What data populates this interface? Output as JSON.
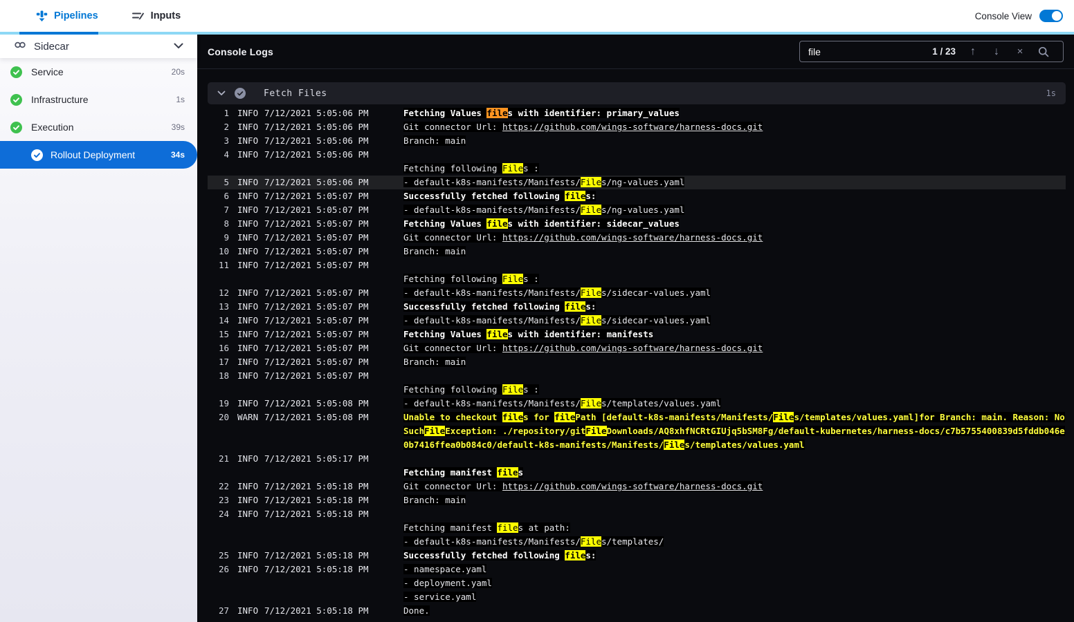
{
  "colors": {
    "accent": "#0278d5",
    "tab_strip": "#8ed8f5",
    "selected_step_bg": "#0e6dd8",
    "success_green": "#3fc14f",
    "match_highlight": "#ffff00",
    "active_match_highlight": "#ff9421",
    "warn_text": "#ffff3d"
  },
  "topbar": {
    "tabs": [
      {
        "label": "Pipelines",
        "active": true
      },
      {
        "label": "Inputs",
        "active": false
      }
    ],
    "console_view_label": "Console View",
    "console_view_on": true
  },
  "sidebar": {
    "stage_label": "Sidecar",
    "steps": [
      {
        "label": "Service",
        "duration": "20s",
        "status": "success",
        "selected": false,
        "indent": false
      },
      {
        "label": "Infrastructure",
        "duration": "1s",
        "status": "success",
        "selected": false,
        "indent": false
      },
      {
        "label": "Execution",
        "duration": "39s",
        "status": "success",
        "selected": false,
        "indent": false
      },
      {
        "label": "Rollout Deployment",
        "duration": "34s",
        "status": "success",
        "selected": true,
        "indent": true
      }
    ]
  },
  "console": {
    "title": "Console Logs",
    "search": {
      "value": "file",
      "counter": "1 / 23"
    },
    "section": {
      "title": "Fetch Files",
      "duration": "1s"
    },
    "highlight": {
      "query": "file",
      "active_match_index": 0
    },
    "highlighted_line": 5,
    "logs": [
      {
        "n": 1,
        "level": "INFO",
        "time": "7/12/2021 5:05:06 PM",
        "style": "bold",
        "msg": "Fetching Values files with identifier: primary_values"
      },
      {
        "n": 2,
        "level": "INFO",
        "time": "7/12/2021 5:05:06 PM",
        "style": "normal",
        "msg": "Git connector Url: https://github.com/wings-software/harness-docs.git"
      },
      {
        "n": 3,
        "level": "INFO",
        "time": "7/12/2021 5:05:06 PM",
        "style": "normal",
        "msg": "Branch: main"
      },
      {
        "n": 4,
        "level": "INFO",
        "time": "7/12/2021 5:05:06 PM",
        "style": "normal",
        "msg": "\nFetching following Files :"
      },
      {
        "n": 5,
        "level": "INFO",
        "time": "7/12/2021 5:05:06 PM",
        "style": "normal",
        "msg": "- default-k8s-manifests/Manifests/Files/ng-values.yaml"
      },
      {
        "n": 6,
        "level": "INFO",
        "time": "7/12/2021 5:05:07 PM",
        "style": "bold",
        "msg": "Successfully fetched following files:"
      },
      {
        "n": 7,
        "level": "INFO",
        "time": "7/12/2021 5:05:07 PM",
        "style": "normal",
        "msg": "- default-k8s-manifests/Manifests/Files/ng-values.yaml"
      },
      {
        "n": 8,
        "level": "INFO",
        "time": "7/12/2021 5:05:07 PM",
        "style": "bold",
        "msg": "Fetching Values files with identifier: sidecar_values"
      },
      {
        "n": 9,
        "level": "INFO",
        "time": "7/12/2021 5:05:07 PM",
        "style": "normal",
        "msg": "Git connector Url: https://github.com/wings-software/harness-docs.git"
      },
      {
        "n": 10,
        "level": "INFO",
        "time": "7/12/2021 5:05:07 PM",
        "style": "normal",
        "msg": "Branch: main"
      },
      {
        "n": 11,
        "level": "INFO",
        "time": "7/12/2021 5:05:07 PM",
        "style": "normal",
        "msg": "\nFetching following Files :"
      },
      {
        "n": 12,
        "level": "INFO",
        "time": "7/12/2021 5:05:07 PM",
        "style": "normal",
        "msg": "- default-k8s-manifests/Manifests/Files/sidecar-values.yaml"
      },
      {
        "n": 13,
        "level": "INFO",
        "time": "7/12/2021 5:05:07 PM",
        "style": "bold",
        "msg": "Successfully fetched following files:"
      },
      {
        "n": 14,
        "level": "INFO",
        "time": "7/12/2021 5:05:07 PM",
        "style": "normal",
        "msg": "- default-k8s-manifests/Manifests/Files/sidecar-values.yaml"
      },
      {
        "n": 15,
        "level": "INFO",
        "time": "7/12/2021 5:05:07 PM",
        "style": "bold",
        "msg": "Fetching Values files with identifier: manifests"
      },
      {
        "n": 16,
        "level": "INFO",
        "time": "7/12/2021 5:05:07 PM",
        "style": "normal",
        "msg": "Git connector Url: https://github.com/wings-software/harness-docs.git"
      },
      {
        "n": 17,
        "level": "INFO",
        "time": "7/12/2021 5:05:07 PM",
        "style": "normal",
        "msg": "Branch: main"
      },
      {
        "n": 18,
        "level": "INFO",
        "time": "7/12/2021 5:05:07 PM",
        "style": "normal",
        "msg": "\nFetching following Files :"
      },
      {
        "n": 19,
        "level": "INFO",
        "time": "7/12/2021 5:05:08 PM",
        "style": "normal",
        "msg": "- default-k8s-manifests/Manifests/Files/templates/values.yaml"
      },
      {
        "n": 20,
        "level": "WARN",
        "time": "7/12/2021 5:05:08 PM",
        "style": "warn",
        "msg": "Unable to checkout files for filePath [default-k8s-manifests/Manifests/Files/templates/values.yaml]for Branch: main. Reason: NoSuchFileException: ./repository/gitFileDownloads/AQ8xhfNCRtGIUjq5bSM8Fg/default-kubernetes/harness-docs/c7b5755400839d5fddb046e0b7416ffea0b084c0/default-k8s-manifests/Manifests/Files/templates/values.yaml"
      },
      {
        "n": 21,
        "level": "INFO",
        "time": "7/12/2021 5:05:17 PM",
        "style": "bold",
        "msg": "\nFetching manifest files"
      },
      {
        "n": 22,
        "level": "INFO",
        "time": "7/12/2021 5:05:18 PM",
        "style": "normal",
        "msg": "Git connector Url: https://github.com/wings-software/harness-docs.git"
      },
      {
        "n": 23,
        "level": "INFO",
        "time": "7/12/2021 5:05:18 PM",
        "style": "normal",
        "msg": "Branch: main"
      },
      {
        "n": 24,
        "level": "INFO",
        "time": "7/12/2021 5:05:18 PM",
        "style": "normal",
        "msg": "\nFetching manifest files at path:\n- default-k8s-manifests/Manifests/Files/templates/"
      },
      {
        "n": 25,
        "level": "INFO",
        "time": "7/12/2021 5:05:18 PM",
        "style": "bold",
        "msg": "Successfully fetched following files:"
      },
      {
        "n": 26,
        "level": "INFO",
        "time": "7/12/2021 5:05:18 PM",
        "style": "normal",
        "msg": "- namespace.yaml\n- deployment.yaml\n- service.yaml"
      },
      {
        "n": 27,
        "level": "INFO",
        "time": "7/12/2021 5:05:18 PM",
        "style": "normal",
        "msg": "Done."
      }
    ]
  }
}
